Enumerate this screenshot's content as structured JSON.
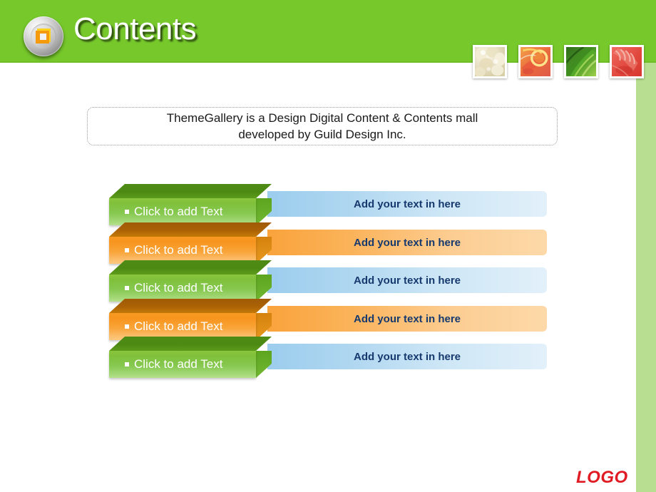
{
  "header": {
    "title": "Contents",
    "icon_name": "square-target-icon",
    "band_color": "#76c82b",
    "thumbnails": [
      {
        "name": "garlic-thumbnail",
        "alt": "garlic cloves"
      },
      {
        "name": "citrus-thumbnail",
        "alt": "orange citrus slice"
      },
      {
        "name": "green-beans-thumbnail",
        "alt": "green beans"
      },
      {
        "name": "tomato-thumbnail",
        "alt": "tomato flesh"
      }
    ]
  },
  "description": {
    "line1": "ThemeGallery is a Design Digital Content & Contents mall",
    "line2": "developed by Guild Design Inc."
  },
  "rows": [
    {
      "color": "green",
      "block_label": "Click to add Text",
      "bar_label": "Add your text in here"
    },
    {
      "color": "orange",
      "block_label": "Click to add Text",
      "bar_label": "Add your text in here"
    },
    {
      "color": "green",
      "block_label": "Click to add Text",
      "bar_label": "Add your text in here"
    },
    {
      "color": "orange",
      "block_label": "Click to add Text",
      "bar_label": "Add your text in here"
    },
    {
      "color": "green",
      "block_label": "Click to add Text",
      "bar_label": "Add your text in here"
    }
  ],
  "footer": {
    "logo_text": "LOGO",
    "logo_color": "#e01b24"
  },
  "theme": {
    "green": "#76c82b",
    "light_green_strip": "#b8df91",
    "orange": "#f7941e",
    "blue_bar": "#9ccdee",
    "bar_text_color": "#16396e"
  }
}
